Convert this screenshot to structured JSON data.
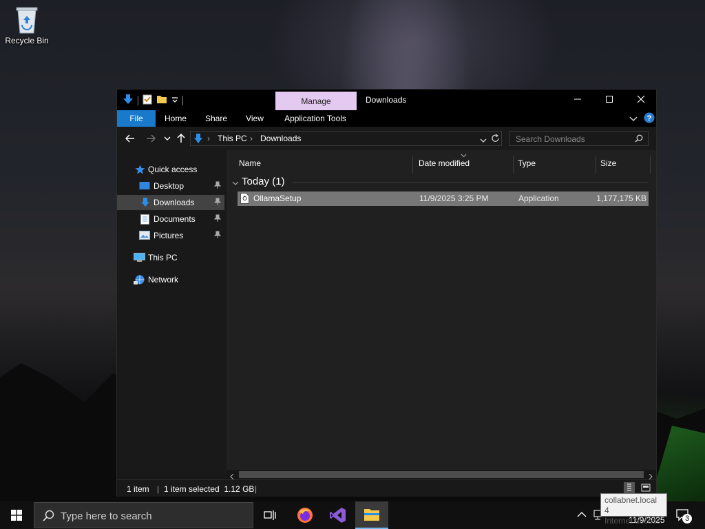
{
  "desktop": {
    "recycle_bin_label": "Recycle Bin"
  },
  "window": {
    "title": "Downloads",
    "context_tab": "Manage",
    "ribbon_tabs": [
      "File",
      "Home",
      "Share",
      "View",
      "Application Tools"
    ],
    "address": {
      "segments": [
        "This PC",
        "Downloads"
      ]
    },
    "search_placeholder": "Search Downloads"
  },
  "nav": {
    "quick_access": "Quick access",
    "items": [
      {
        "label": "Desktop",
        "pinned": true
      },
      {
        "label": "Downloads",
        "pinned": true
      },
      {
        "label": "Documents",
        "pinned": true
      },
      {
        "label": "Pictures",
        "pinned": true
      }
    ],
    "this_pc": "This PC",
    "network": "Network"
  },
  "columns": [
    "Name",
    "Date modified",
    "Type",
    "Size"
  ],
  "group_label": "Today (1)",
  "files": [
    {
      "name": "OllamaSetup",
      "date_modified": "11/9/2025 3:25 PM",
      "type": "Application",
      "size": "1,177,175 KB"
    }
  ],
  "status": {
    "count": "1 item",
    "selected": "1 item selected  1.12 GB"
  },
  "taskbar": {
    "search_placeholder": "Type here to search",
    "clock_date": "11/9/2025",
    "notifications_count": "3",
    "tooltip_line1": "collabnet.local 4",
    "tooltip_line2": "Internet access"
  },
  "colors": {
    "accent": "#1979ca",
    "manage_tab": "#e4c9f0",
    "selection": "#777777"
  }
}
